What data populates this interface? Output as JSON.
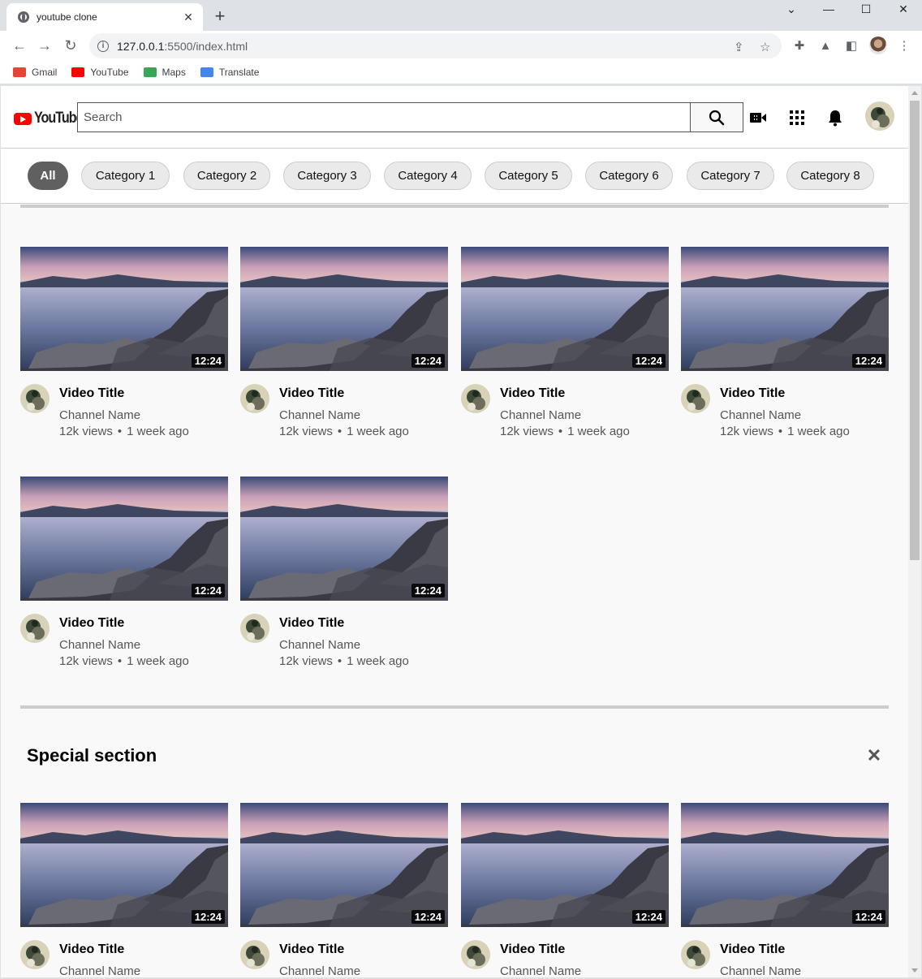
{
  "browser": {
    "tab_title": "youtube clone",
    "url_host": "127.0.0.1",
    "url_rest": ":5500/index.html",
    "bookmarks": [
      {
        "label": "Gmail",
        "color": "#EA4335"
      },
      {
        "label": "YouTube",
        "color": "#FF0000"
      },
      {
        "label": "Maps",
        "color": "#34A853"
      },
      {
        "label": "Translate",
        "color": "#4285F4"
      }
    ]
  },
  "header": {
    "logo_text": "YouTube",
    "search_placeholder": "Search"
  },
  "categories": [
    "All",
    "Category 1",
    "Category 2",
    "Category 3",
    "Category 4",
    "Category 5",
    "Category 6",
    "Category 7",
    "Category 8"
  ],
  "videos": [
    {
      "title": "Video Title",
      "channel": "Channel Name",
      "views": "12k views",
      "age": "1 week ago",
      "duration": "12:24"
    },
    {
      "title": "Video Title",
      "channel": "Channel Name",
      "views": "12k views",
      "age": "1 week ago",
      "duration": "12:24"
    },
    {
      "title": "Video Title",
      "channel": "Channel Name",
      "views": "12k views",
      "age": "1 week ago",
      "duration": "12:24"
    },
    {
      "title": "Video Title",
      "channel": "Channel Name",
      "views": "12k views",
      "age": "1 week ago",
      "duration": "12:24"
    },
    {
      "title": "Video Title",
      "channel": "Channel Name",
      "views": "12k views",
      "age": "1 week ago",
      "duration": "12:24"
    },
    {
      "title": "Video Title",
      "channel": "Channel Name",
      "views": "12k views",
      "age": "1 week ago",
      "duration": "12:24"
    }
  ],
  "special_section": {
    "title": "Special section",
    "close_label": "✕",
    "videos": [
      {
        "title": "Video Title",
        "channel": "Channel Name",
        "duration": "12:24"
      },
      {
        "title": "Video Title",
        "channel": "Channel Name",
        "duration": "12:24"
      },
      {
        "title": "Video Title",
        "channel": "Channel Name",
        "duration": "12:24"
      },
      {
        "title": "Video Title",
        "channel": "Channel Name",
        "duration": "12:24"
      }
    ]
  }
}
